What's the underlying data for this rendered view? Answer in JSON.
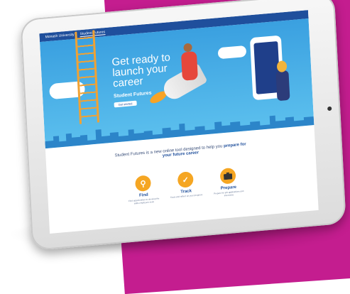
{
  "nav": {
    "brand": "Monash University",
    "tab": "Student Futures"
  },
  "hero": {
    "title": "Get ready to launch your career",
    "subtitle": "Student Futures",
    "button": "Get started"
  },
  "intro": {
    "text": "Student Futures is a new online tool designed to help you",
    "highlight": "prepare for your future career"
  },
  "features": [
    {
      "icon": "search-icon",
      "label": "Find",
      "desc": "Find opportunities to develop the skills employers seek"
    },
    {
      "icon": "check-icon",
      "label": "Track",
      "desc": "Track and reflect on your progress"
    },
    {
      "icon": "briefcase-icon",
      "label": "Prepare",
      "desc": "Prepare for job applications and interviews"
    }
  ],
  "colors": {
    "backdrop": "#c41d8f",
    "hero_sky": "#3aa0e0",
    "nav": "#1f4f9c",
    "icon": "#f5a623"
  }
}
